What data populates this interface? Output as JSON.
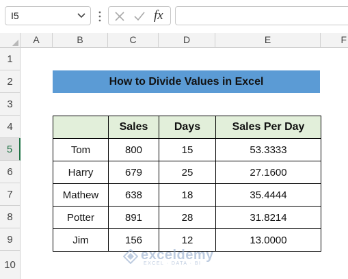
{
  "formula_bar": {
    "name_box": "I5",
    "fx_label": "fx",
    "formula": ""
  },
  "columns": [
    "A",
    "B",
    "C",
    "D",
    "E",
    "F"
  ],
  "rows": [
    "1",
    "2",
    "3",
    "4",
    "5",
    "6",
    "7",
    "8",
    "9",
    "10"
  ],
  "active_row": "5",
  "title": "How to Divide Values in Excel",
  "table": {
    "headers": [
      "",
      "Sales",
      "Days",
      "Sales Per Day"
    ],
    "rows": [
      [
        "Tom",
        "800",
        "15",
        "53.3333"
      ],
      [
        "Harry",
        "679",
        "25",
        "27.1600"
      ],
      [
        "Mathew",
        "638",
        "18",
        "35.4444"
      ],
      [
        "Potter",
        "891",
        "28",
        "31.8214"
      ],
      [
        "Jim",
        "156",
        "12",
        "13.0000"
      ]
    ]
  },
  "watermark": {
    "name": "exceldemy",
    "tagline": "EXCEL · DATA · BI"
  },
  "colors": {
    "title_fill": "#5b9bd5",
    "header_fill": "#e2efda",
    "active_accent": "#217346"
  }
}
